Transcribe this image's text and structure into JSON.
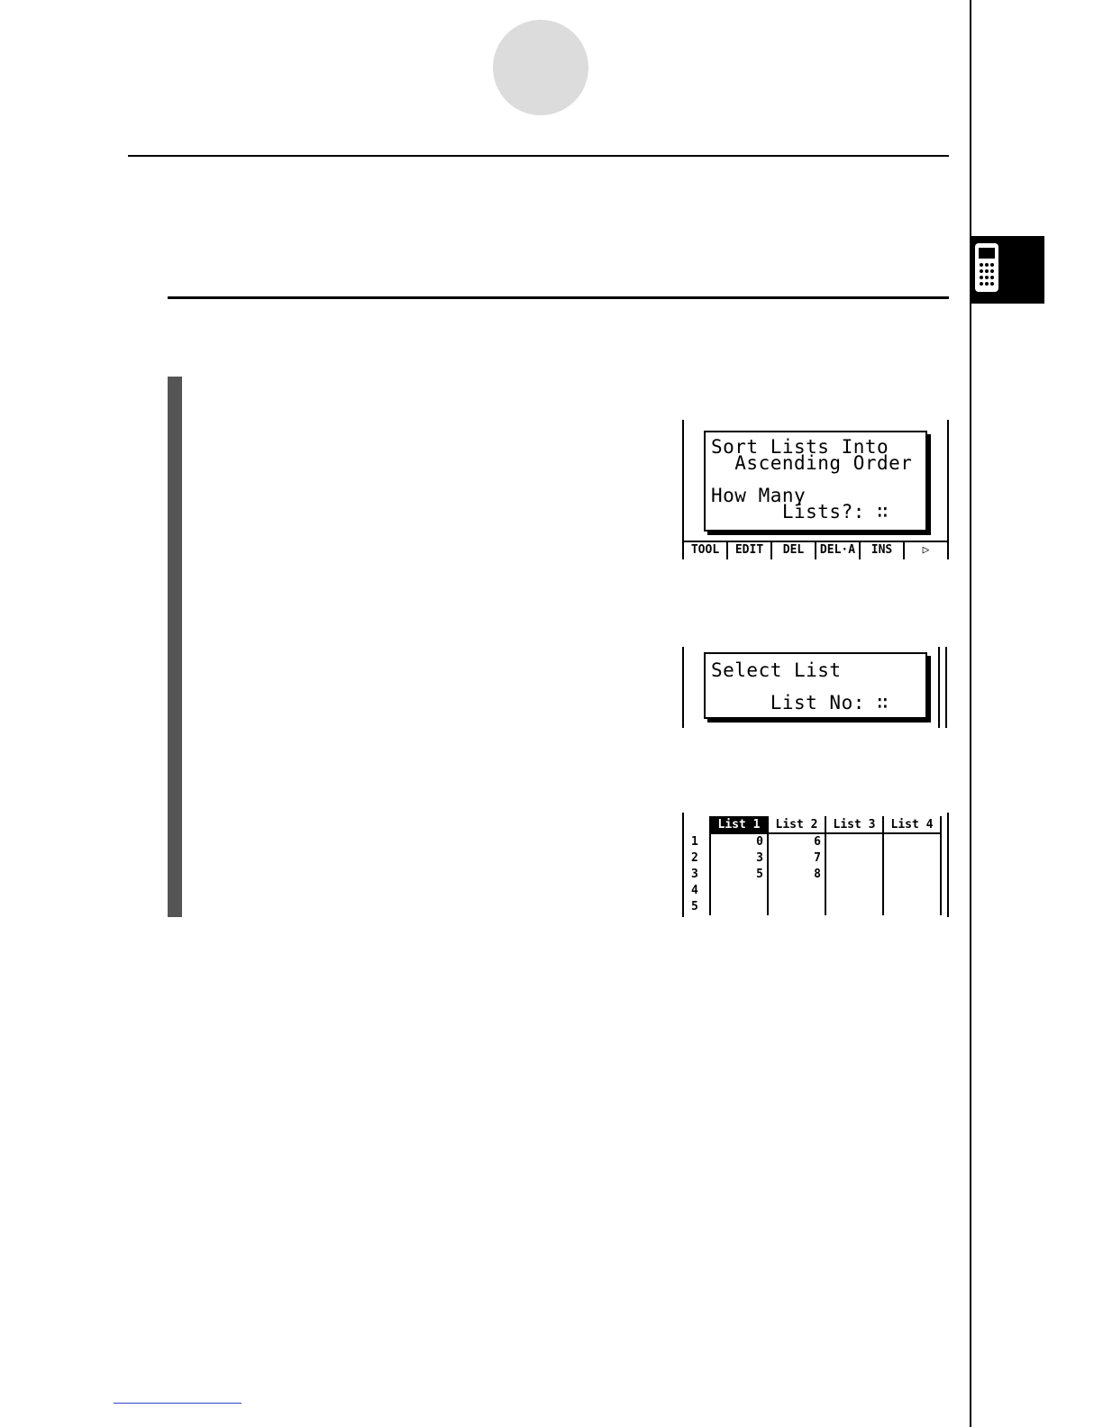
{
  "side_tab": {
    "icon": "calculator-icon"
  },
  "screen1": {
    "dialog_lines": [
      "Sort Lists Into",
      "  Ascending Order",
      "",
      "How Many",
      "      Lists?: ∷"
    ],
    "function_keys": [
      "TOOL",
      "EDIT",
      "DEL",
      "DEL·A",
      "INS",
      "▷"
    ]
  },
  "screen2": {
    "dialog_lines": [
      "Select List",
      "",
      "     List No: ∷"
    ]
  },
  "screen3": {
    "headers": [
      "List 1",
      "List 2",
      "List 3",
      "List 4"
    ],
    "active_header": 0,
    "rows": [
      {
        "num": "1",
        "cells": [
          "0",
          "6",
          "",
          ""
        ]
      },
      {
        "num": "2",
        "cells": [
          "3",
          "7",
          "",
          ""
        ]
      },
      {
        "num": "3",
        "cells": [
          "5",
          "8",
          "",
          ""
        ]
      },
      {
        "num": "4",
        "cells": [
          "",
          "",
          "",
          ""
        ]
      },
      {
        "num": "5",
        "cells": [
          "",
          "",
          "",
          ""
        ]
      }
    ]
  }
}
